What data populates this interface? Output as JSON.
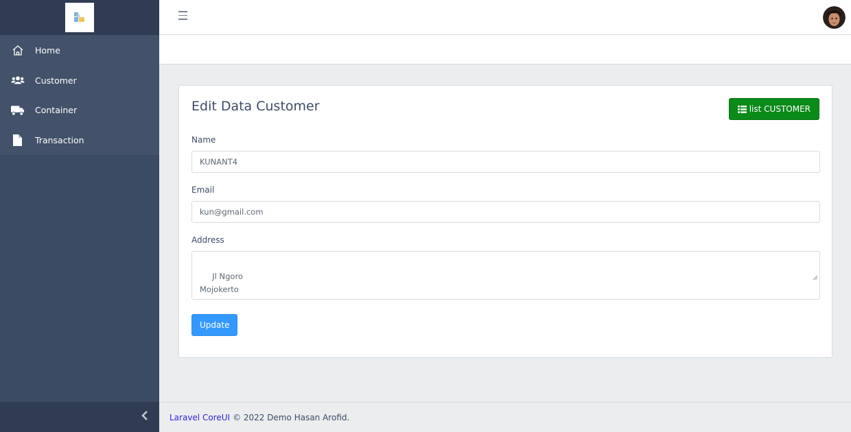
{
  "sidebar": {
    "brand_icon": "app-logo",
    "items": [
      {
        "label": "Home",
        "icon": "home-icon"
      },
      {
        "label": "Customer",
        "icon": "users-icon"
      },
      {
        "label": "Container",
        "icon": "truck-icon"
      },
      {
        "label": "Transaction",
        "icon": "file-icon"
      }
    ],
    "minimize_icon": "chevron-left-icon"
  },
  "header": {
    "toggler_icon": "hamburger-icon",
    "avatar": "user-avatar"
  },
  "form": {
    "title": "Edit Data Customer",
    "list_button_label": "list CUSTOMER",
    "name_label": "Name",
    "name_value": "KUNANT4",
    "email_label": "Email",
    "email_value": "kun@gmail.com",
    "address_label": "Address",
    "address_value": " Jl Ngoro\nMojokerto",
    "update_label": "Update"
  },
  "footer": {
    "link_text": "Laravel CoreUI",
    "copyright_text": "© 2022 Demo Hasan Arofid."
  },
  "colors": {
    "sidebar_bg": "#3c4b64",
    "primary": "#3399ff",
    "success": "#0b8a1a",
    "link": "#321fdb"
  }
}
